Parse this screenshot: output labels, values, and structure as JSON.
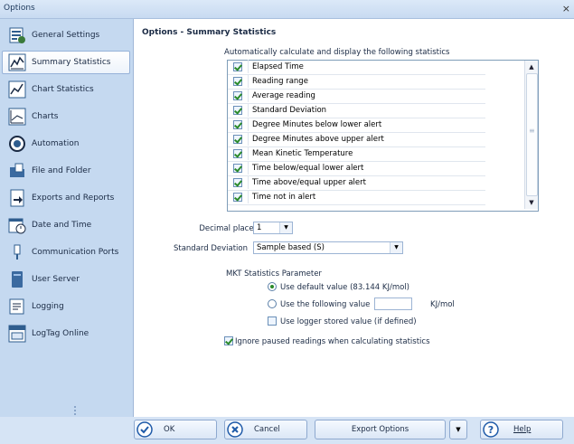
{
  "window": {
    "title": "Options",
    "close_glyph": "×"
  },
  "sidebar": {
    "items": [
      {
        "label": "General Settings",
        "icon": "general-settings-icon"
      },
      {
        "label": "Summary Statistics",
        "icon": "summary-statistics-icon",
        "active": true
      },
      {
        "label": "Chart Statistics",
        "icon": "chart-statistics-icon"
      },
      {
        "label": "Charts",
        "icon": "charts-icon"
      },
      {
        "label": "Automation",
        "icon": "automation-icon"
      },
      {
        "label": "File and Folder",
        "icon": "file-folder-icon"
      },
      {
        "label": "Exports and Reports",
        "icon": "exports-reports-icon"
      },
      {
        "label": "Date and Time",
        "icon": "date-time-icon"
      },
      {
        "label": "Communication Ports",
        "icon": "communication-ports-icon"
      },
      {
        "label": "User Server",
        "icon": "user-server-icon"
      },
      {
        "label": "Logging",
        "icon": "logging-icon"
      },
      {
        "label": "LogTag Online",
        "icon": "logtag-online-icon"
      }
    ]
  },
  "main": {
    "section_title": "Options - Summary Statistics",
    "subtitle": "Automatically calculate and display the following statistics",
    "statistics": [
      {
        "label": "Elapsed Time",
        "checked": true
      },
      {
        "label": "Reading range",
        "checked": true
      },
      {
        "label": "Average reading",
        "checked": true
      },
      {
        "label": "Standard Deviation",
        "checked": true
      },
      {
        "label": "Degree Minutes below lower alert",
        "checked": true
      },
      {
        "label": "Degree Minutes above upper alert",
        "checked": true
      },
      {
        "label": "Mean Kinetic Temperature",
        "checked": true
      },
      {
        "label": "Time below/equal lower alert",
        "checked": true
      },
      {
        "label": "Time above/equal upper alert",
        "checked": true
      },
      {
        "label": "Time not in alert",
        "checked": true
      }
    ],
    "decimal_places": {
      "label": "Decimal places",
      "value": "1"
    },
    "standard_deviation": {
      "label": "Standard Deviation",
      "value": "Sample based (S)"
    },
    "mkt": {
      "title": "MKT Statistics Parameter",
      "default_option": "Use default value (83.144 KJ/mol)",
      "custom_option": "Use the following value",
      "custom_value": "",
      "unit": "KJ/mol",
      "logger_option": "Use logger stored value (if defined)",
      "selected": "default"
    },
    "ignore_paused": {
      "label": "Ignore paused readings when calculating statistics",
      "checked": true
    }
  },
  "footer": {
    "ok_label": "OK",
    "cancel_label": "Cancel",
    "export_label": "Export Options",
    "help_label": "Help"
  },
  "colors": {
    "accent": "#1e5aa8",
    "check": "#2a8a2a",
    "sidebar_bg": "#c5d9f0"
  }
}
